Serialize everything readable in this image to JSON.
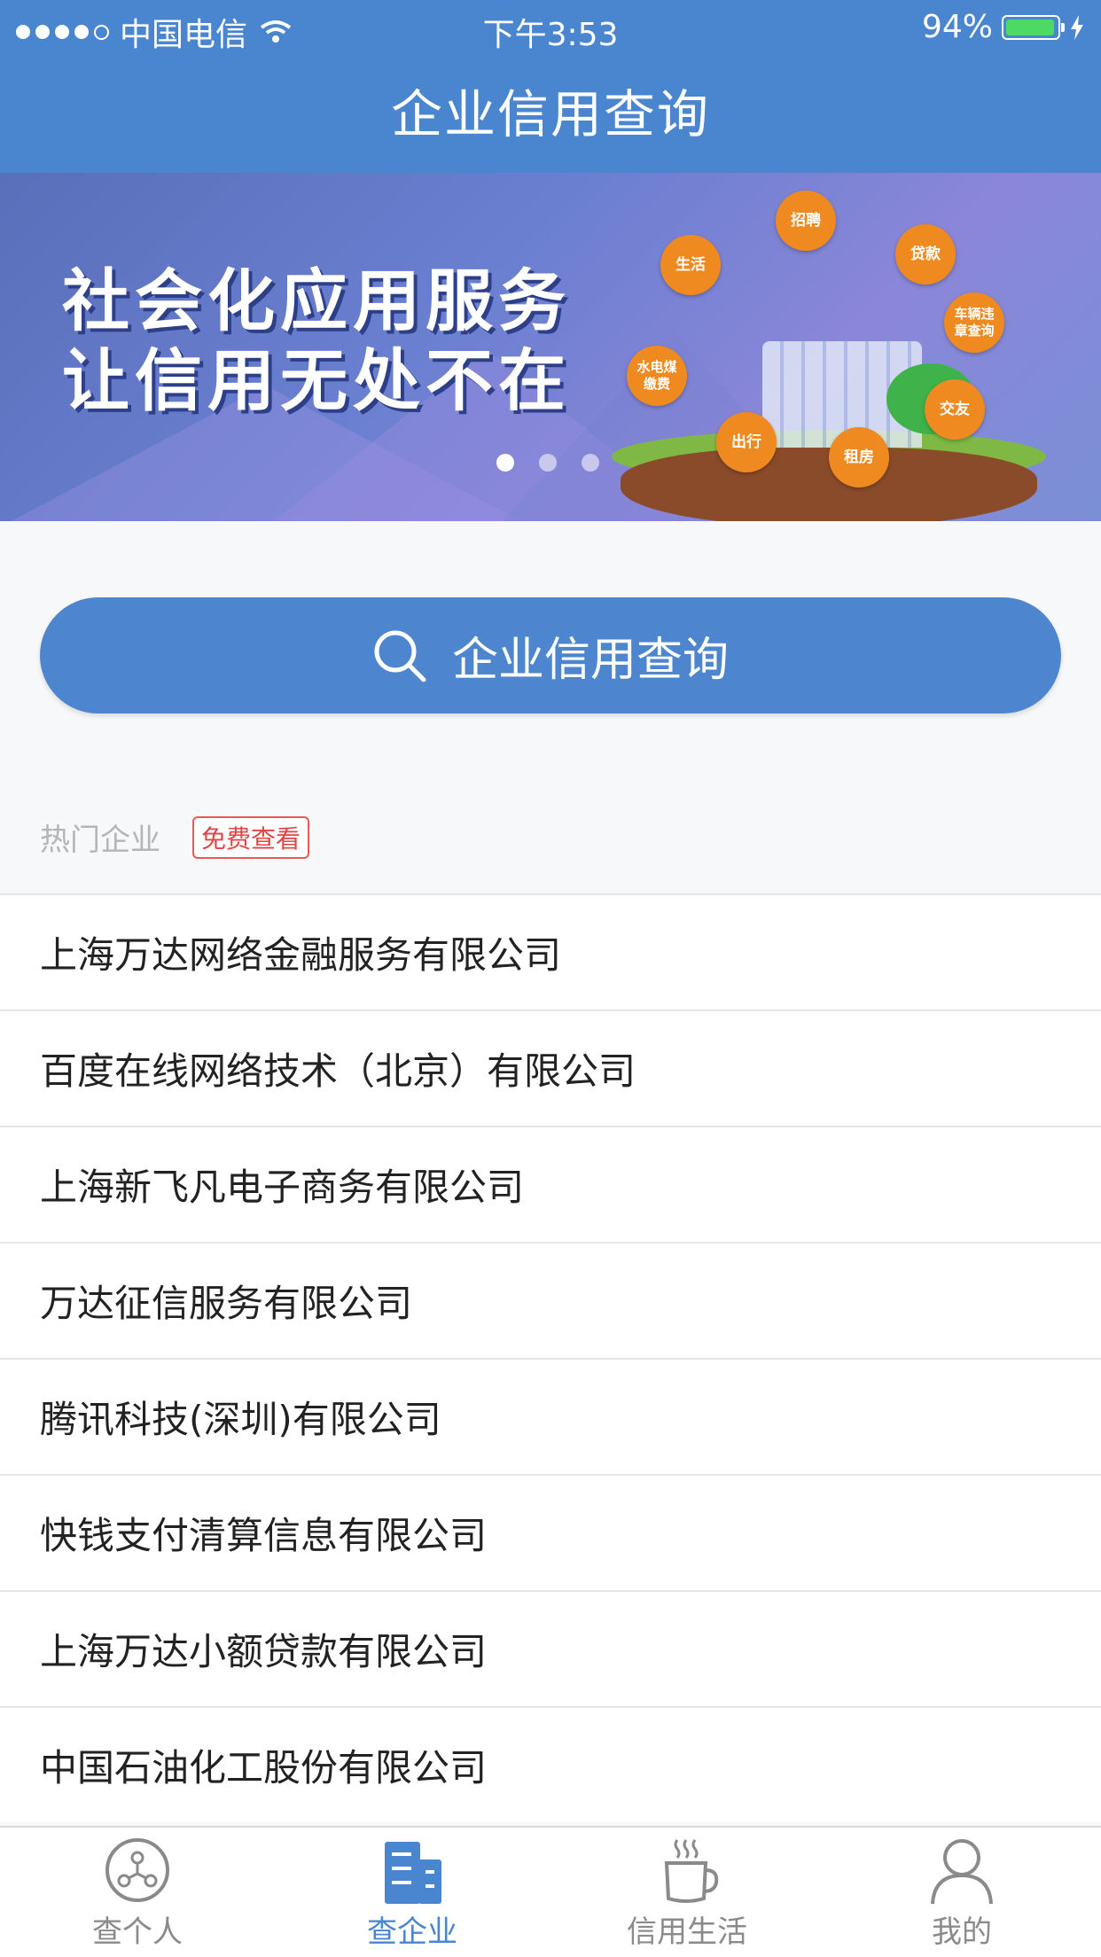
{
  "status_bar": {
    "carrier": "中国电信",
    "time": "下午3:53",
    "battery": "94%"
  },
  "header": {
    "title": "企业信用查询"
  },
  "banner": {
    "slogan_line1": "社会化应用服务",
    "slogan_line2": "让信用无处不在",
    "tags": [
      "招聘",
      "生活",
      "贷款",
      "车辆违章查询",
      "水电煤缴费",
      "交友",
      "出行",
      "租房"
    ],
    "pager": {
      "count": 3,
      "active": 1
    }
  },
  "search": {
    "label": "企业信用查询"
  },
  "hot": {
    "label": "热门企业",
    "badge": "免费查看",
    "companies": [
      "上海万达网络金融服务有限公司",
      "百度在线网络技术（北京）有限公司",
      "上海新飞凡电子商务有限公司",
      "万达征信服务有限公司",
      "腾讯科技(深圳)有限公司",
      "快钱支付清算信息有限公司",
      "上海万达小额贷款有限公司",
      "中国石油化工股份有限公司"
    ]
  },
  "tabbar": {
    "tabs": [
      {
        "label": "查个人",
        "icon": "person-network-icon"
      },
      {
        "label": "查企业",
        "icon": "building-icon"
      },
      {
        "label": "信用生活",
        "icon": "coffee-cup-icon"
      },
      {
        "label": "我的",
        "icon": "user-icon"
      }
    ],
    "active_index": 1
  },
  "colors": {
    "primary": "#4a86d0",
    "tag_orange": "#ef8a20",
    "badge_red": "#e04444"
  }
}
